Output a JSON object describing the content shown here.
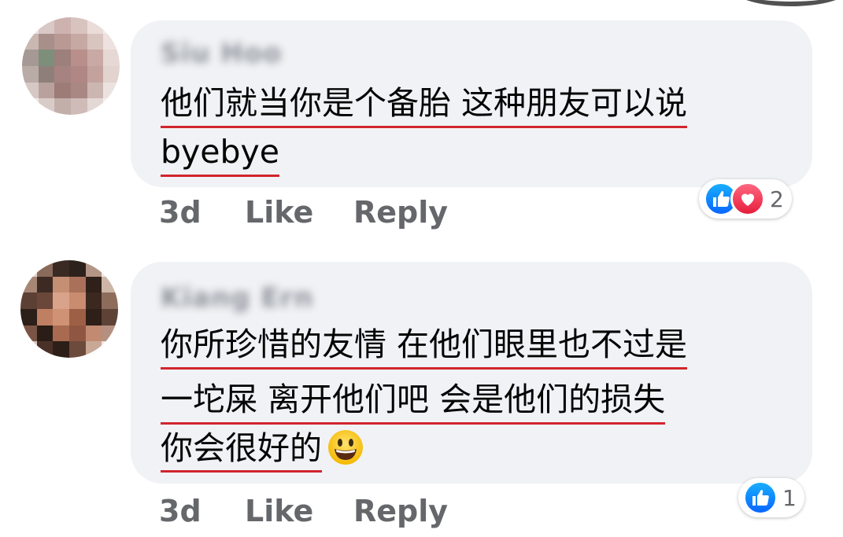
{
  "comments": [
    {
      "author": "Siu Hoo",
      "lines": [
        "他们就当你是个备胎 这种朋友可以说",
        "byebye"
      ],
      "time": "3d",
      "like_label": "Like",
      "reply_label": "Reply",
      "reaction_count": "2",
      "reactions": [
        "like-icon",
        "love-icon"
      ]
    },
    {
      "author": "Kiang Ern",
      "lines": [
        "你所珍惜的友情 在他们眼里也不过是",
        "一坨屎 离开他们吧 会是他们的损失",
        "你会很好的"
      ],
      "emoji": "grinning-face-emoji",
      "time": "3d",
      "like_label": "Like",
      "reply_label": "Reply",
      "reaction_count": "1",
      "reactions": [
        "like-icon"
      ]
    }
  ],
  "colors": {
    "bubble": "#f0f2f5",
    "underline": "#d2242d",
    "meta_text": "#65676b",
    "like_blue": "#0866ff",
    "love_red": "#e61e3d"
  }
}
